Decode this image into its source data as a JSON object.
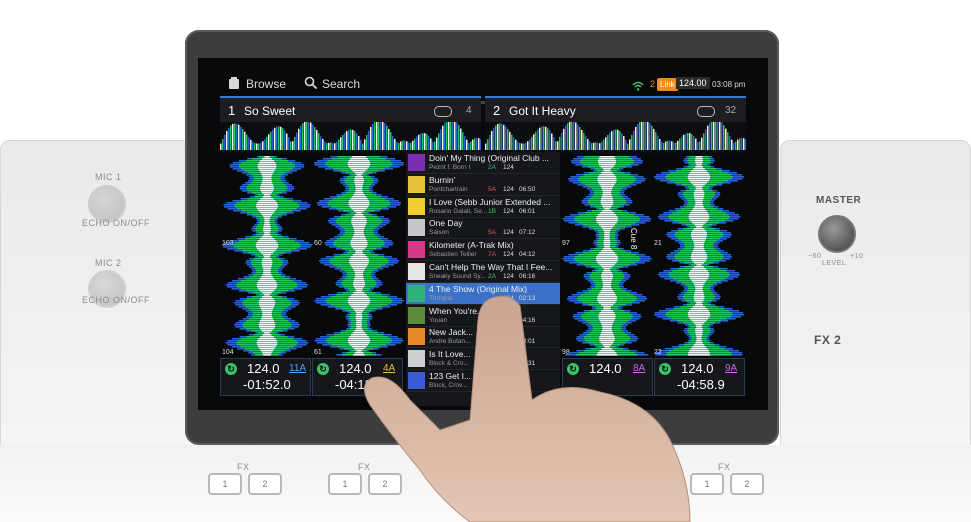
{
  "hardware": {
    "left": {
      "mic1": "MIC 1",
      "echo_onoff": "ECHO ON/OFF",
      "mic2": "MIC 2",
      "echo_onoff2": "ECHO ON/OFF"
    },
    "right": {
      "master": "MASTER",
      "level": "LEVEL",
      "level_min": "−60",
      "level_max": "+10",
      "fx2": "FX 2",
      "fx_label": "FX",
      "btn1": "1",
      "btn2": "2"
    }
  },
  "topbar": {
    "browse_label": "Browse",
    "search_label": "Search",
    "link_count": "2",
    "link_label": "Link",
    "master_bpm": "124.00",
    "clock": "03:08 pm"
  },
  "decks": [
    {
      "number": "1",
      "title": "So Sweet",
      "loop_count": "4"
    },
    {
      "number": "2",
      "title": "Got It Heavy",
      "loop_count": "32"
    }
  ],
  "beat_markers": {
    "col1_top": "103",
    "col2_top": "60",
    "col3_top": "97",
    "col4_top": "21",
    "col1_bottom": "104",
    "col2_bottom": "61",
    "col3_bottom": "98",
    "col4_bottom": "22",
    "cue_label": "Cue 8"
  },
  "browser": {
    "tracks": [
      {
        "title": "Doin' My Thing (Original Club ...",
        "artist": "Peznt f. Born I",
        "key": "2A",
        "bpm": "124",
        "duration": "",
        "art_color": "#7a2fb0"
      },
      {
        "title": "Burnin'",
        "artist": "Pontchartrain",
        "key": "5A",
        "bpm": "124",
        "duration": "06:50",
        "art_color": "#e8c23a"
      },
      {
        "title": "I Love (Sebb Junior Extended ...",
        "artist": "Rosario Galati, Se...",
        "key": "1B",
        "bpm": "124",
        "duration": "06:01",
        "art_color": "#f2cc32"
      },
      {
        "title": "One Day",
        "artist": "Saison",
        "key": "5A",
        "bpm": "124",
        "duration": "07:12",
        "art_color": "#c7c7c7"
      },
      {
        "title": "Kilometer (A-Trak Mix)",
        "artist": "Sebastien Tellier",
        "key": "7A",
        "bpm": "124",
        "duration": "04:12",
        "art_color": "#d63a8a"
      },
      {
        "title": "Can't Help The Way That I Fee...",
        "artist": "Sneaky Sound Sy...",
        "key": "2A",
        "bpm": "124",
        "duration": "06:16",
        "art_color": "#e6e6e6"
      },
      {
        "title": "4 The Show (Original Mix)",
        "artist": "Trutopia",
        "key": "",
        "bpm": "124",
        "duration": "02:13",
        "art_color": "#2fb37a"
      },
      {
        "title": "When You're...",
        "artist": "Youan",
        "key": "",
        "bpm": "",
        "duration": "04:16",
        "art_color": "#5e8a3c"
      },
      {
        "title": "New Jack...",
        "artist": "Andre Butan...",
        "key": "",
        "bpm": "",
        "duration": "08:01",
        "art_color": "#e48a2a"
      },
      {
        "title": "Is It Love...",
        "artist": "Block & Cro...",
        "key": "",
        "bpm": "",
        "duration": "05:31",
        "art_color": "#cfcfcf"
      },
      {
        "title": "123 Get I...",
        "artist": "Block, Crov...",
        "key": "",
        "bpm": "",
        "duration": "",
        "art_color": "#3a5bd6"
      }
    ],
    "selected_index": 6
  },
  "deck_info": [
    {
      "bpm": "124.0",
      "key": "11A",
      "time": "-01:52.0",
      "key_color": "#4aa3ff"
    },
    {
      "bpm": "124.0",
      "key": "4A",
      "time": "-04:12.9",
      "key_color": "#e8c23a"
    },
    {
      "bpm": "124.0",
      "key": "8A",
      "time": "",
      "key_color": "#c46be0"
    },
    {
      "bpm": "124.0",
      "key": "9A",
      "time": "-04:58.9",
      "key_color": "#c46be0"
    }
  ],
  "colors": {
    "wave_green": "#23c65a",
    "wave_blue": "#2a62d8",
    "wave_white": "#f2f6f2",
    "accent": "#3a7bd5"
  }
}
